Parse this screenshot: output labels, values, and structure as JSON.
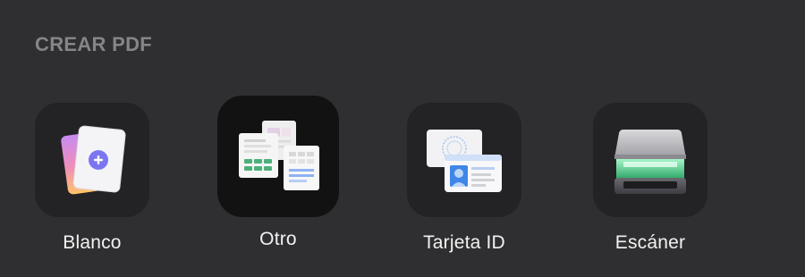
{
  "section": {
    "title": "CREAR PDF"
  },
  "tiles": [
    {
      "label": "Blanco",
      "icon": "blank-pages-plus-icon"
    },
    {
      "label": "Otro",
      "icon": "other-documents-icon"
    },
    {
      "label": "Tarjeta ID",
      "icon": "id-card-icon"
    },
    {
      "label": "Escáner",
      "icon": "scanner-icon"
    }
  ],
  "colors": {
    "background": "#2f2f31",
    "tile_background": "#232325",
    "tile_selected_background": "#121212",
    "title_color": "#858587",
    "label_color": "#f2f2f2",
    "accent_plus": "#7b76f0",
    "scanner_light": "#5fe0a0"
  }
}
